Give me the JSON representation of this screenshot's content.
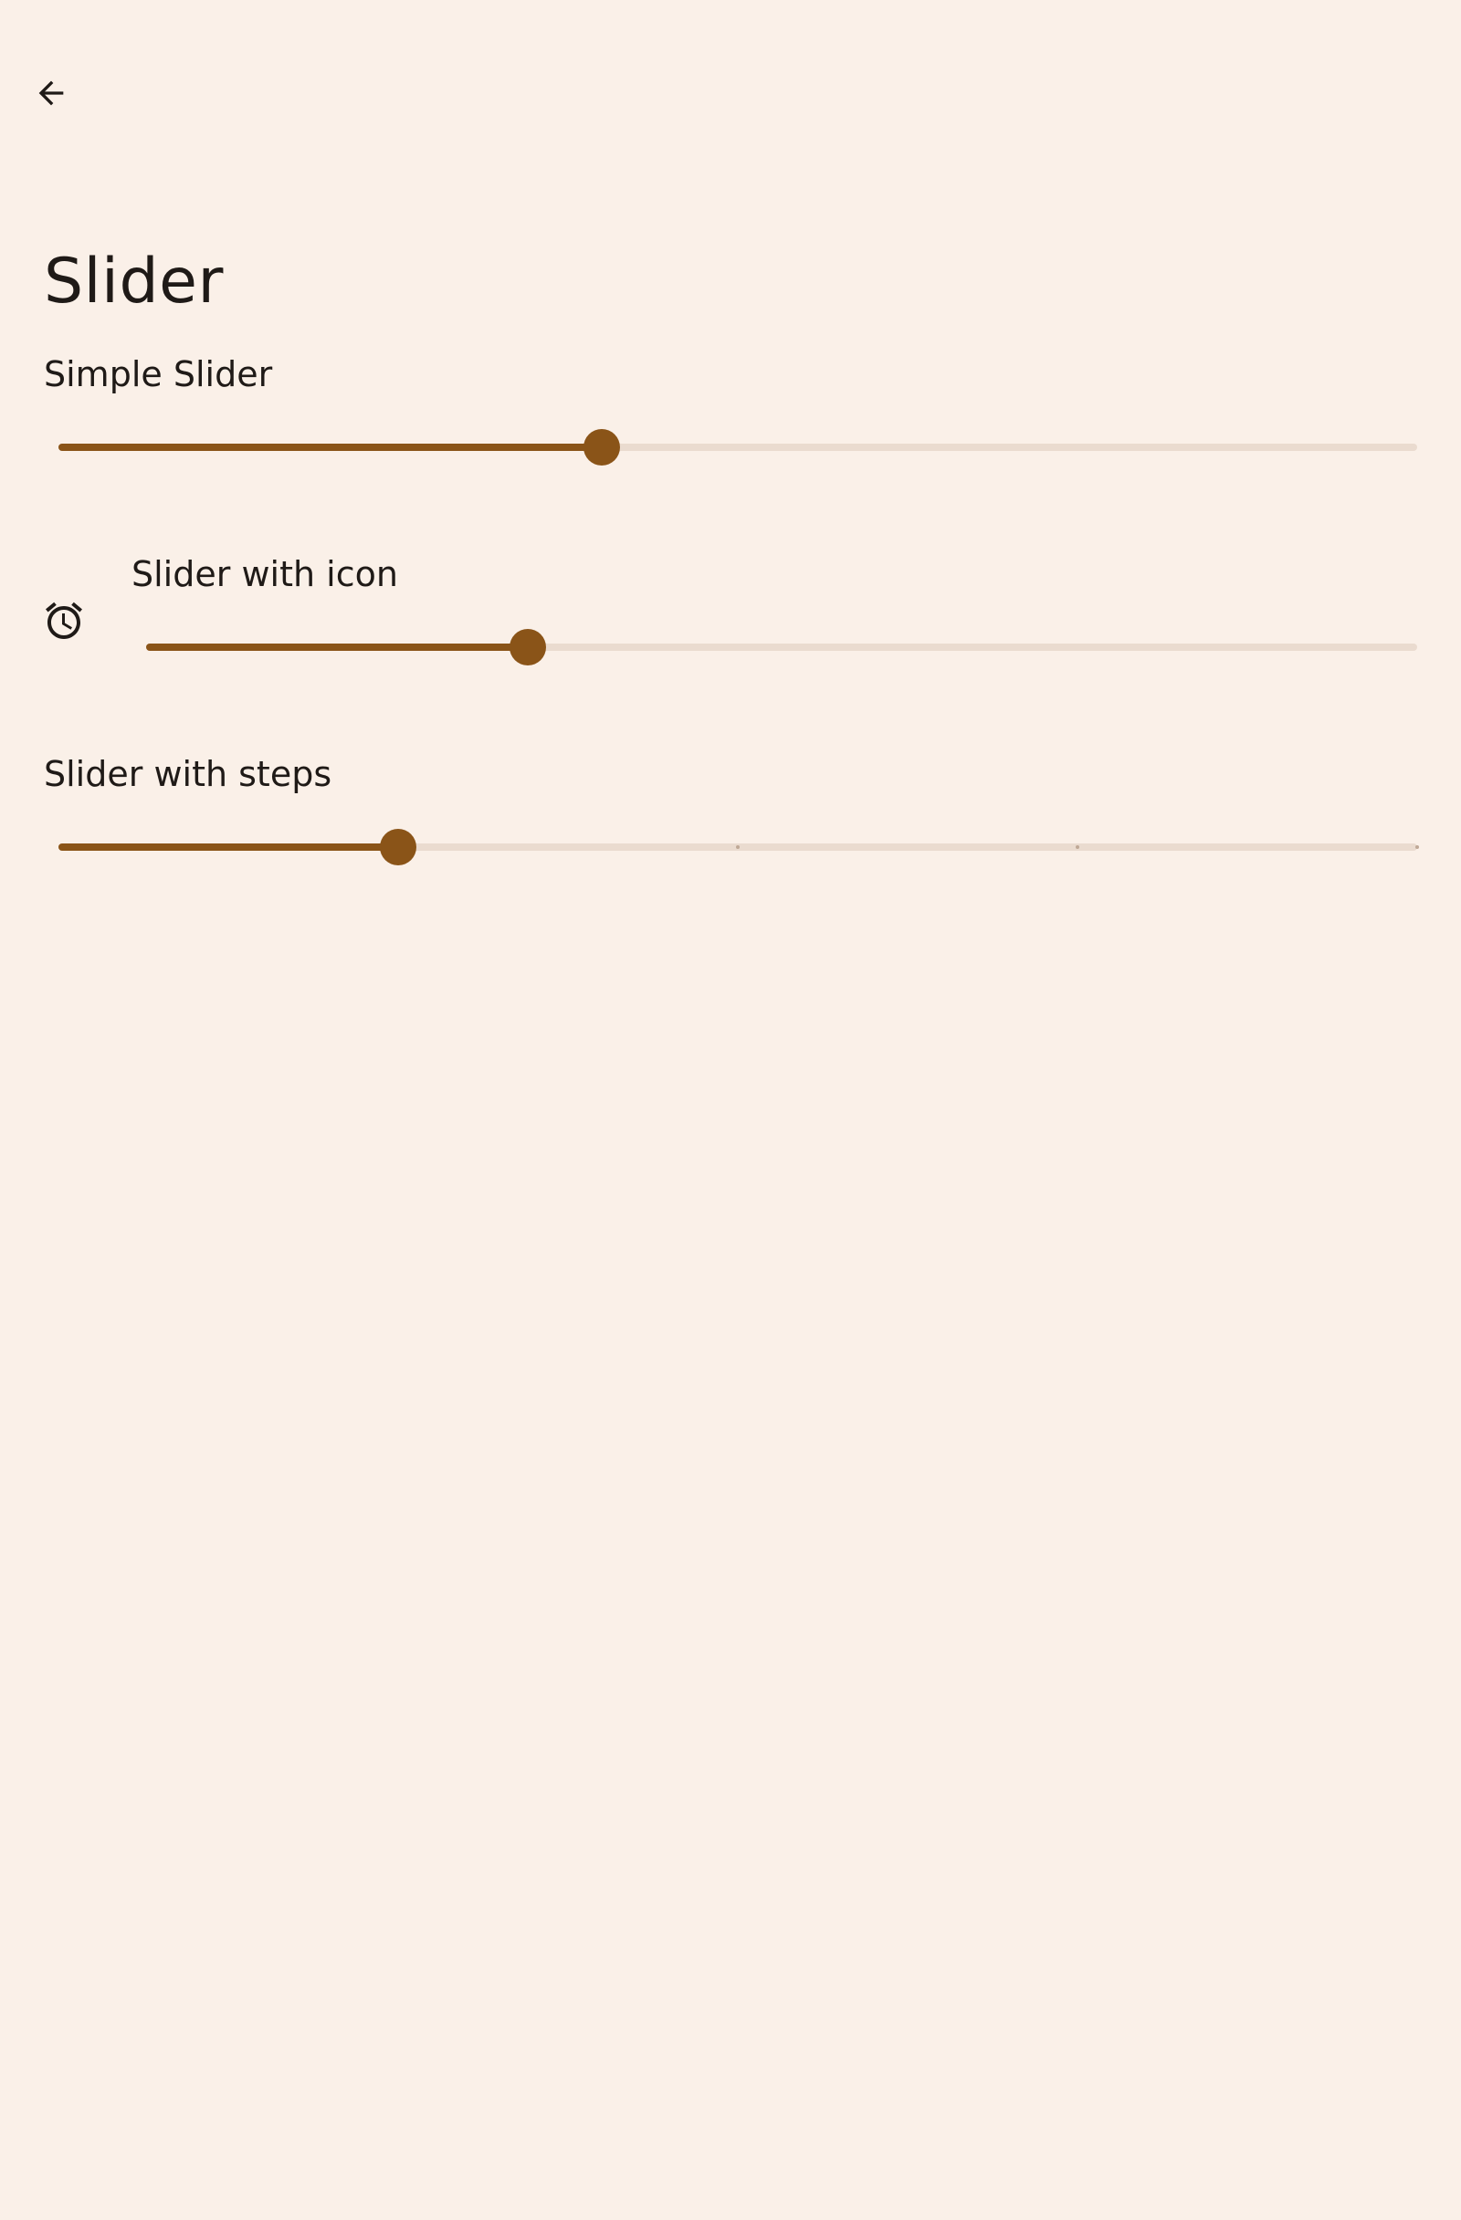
{
  "header": {
    "back_icon": "arrow-back-icon"
  },
  "page": {
    "title": "Slider"
  },
  "sliders": [
    {
      "label": "Simple Slider",
      "value_fraction": 0.4
    },
    {
      "label": "Slider with icon",
      "icon": "alarm-icon",
      "value_fraction": 0.3
    },
    {
      "label": "Slider with steps",
      "value_fraction": 0.25,
      "step_count": 4
    }
  ],
  "colors": {
    "background": "#FAF0E8",
    "accent": "#8A5418",
    "track_inactive": "#EADBCF",
    "text": "#1F1A17"
  }
}
